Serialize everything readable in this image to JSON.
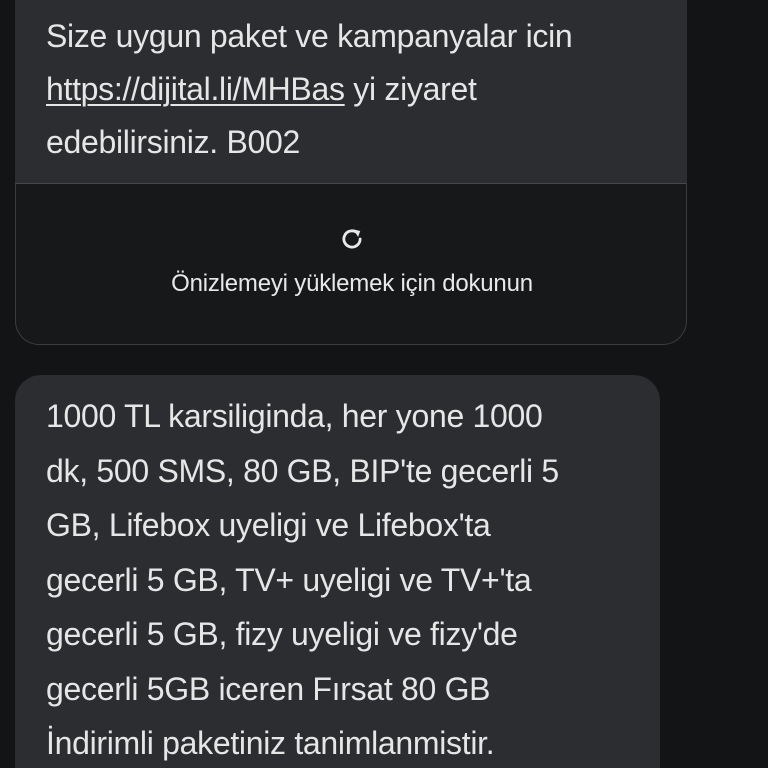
{
  "message1": {
    "lines": [
      "Size uygun paket ve kampanyalar icin",
      "yi ziyaret",
      "edebilirsiniz. B002"
    ],
    "link_text": "https://dijital.li/MHBas"
  },
  "link_preview": {
    "icon": "refresh-icon",
    "label": "Önizlemeyi yüklemek için dokunun"
  },
  "message2": {
    "lines": [
      "1000 TL karsiliginda, her yone 1000",
      "dk, 500 SMS, 80 GB, BIP'te gecerli 5",
      "GB, Lifebox uyeligi ve Lifebox'ta",
      "gecerli 5 GB, TV+ uyeligi ve TV+'ta",
      "gecerli 5 GB, fizy uyeligi ve fizy'de",
      "gecerli 5GB iceren Fırsat 80 GB",
      "İndirimli paketiniz tanimlanmistir."
    ]
  },
  "colors": {
    "background": "#131416",
    "bubble": "#2b2d30",
    "preview": "#16181a",
    "text": "#e6e6e6"
  }
}
